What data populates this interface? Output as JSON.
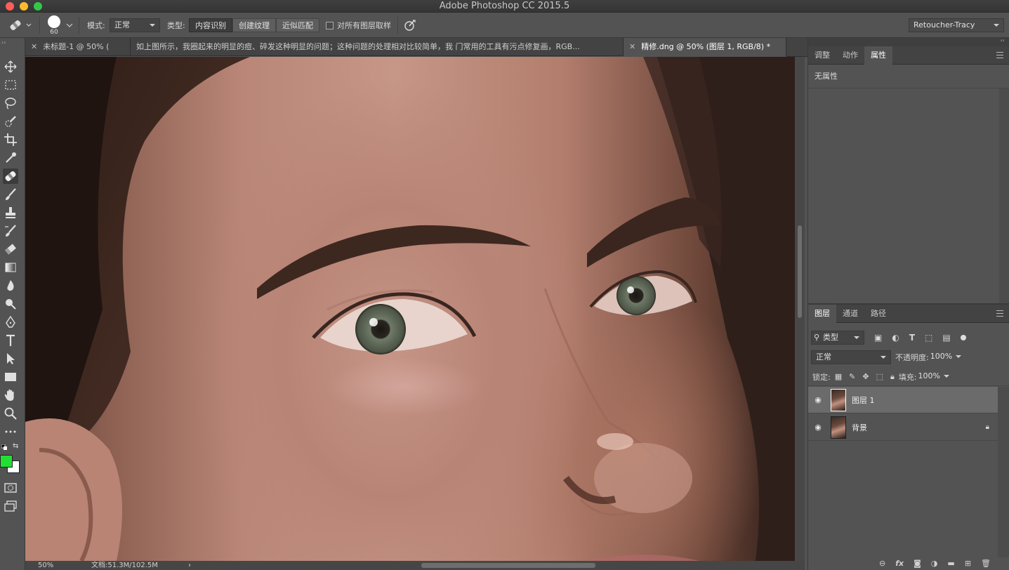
{
  "window": {
    "title": "Adobe Photoshop CC 2015.5"
  },
  "options": {
    "brush_size": "60",
    "mode_label": "模式:",
    "mode_value": "正常",
    "type_label": "类型:",
    "type_buttons": [
      "内容识别",
      "创建纹理",
      "近似匹配"
    ],
    "sample_all_label": "对所有图层取样",
    "workspace": "Retoucher-Tracy"
  },
  "doc_tabs": [
    {
      "label": "未标题-1 @ 50% (",
      "active": false
    },
    {
      "label": "如上图所示，我圈起来的明显的痘、碎发这种明显的问题；这种问题的处理相对比较简单，我 门常用的工具有污点修复画，RGB...",
      "active": false
    },
    {
      "label": "精修.dng @ 50% (图层 1, RGB/8) *",
      "active": true
    }
  ],
  "status": {
    "zoom": "50%",
    "doc_size": "文档:51.3M/102.5M"
  },
  "properties_panel": {
    "tabs": [
      "调整",
      "动作",
      "属性"
    ],
    "active_tab": "属性",
    "content": "无属性"
  },
  "layers_panel": {
    "tabs": [
      "图层",
      "通道",
      "路径"
    ],
    "active_tab": "图层",
    "filter_label": "类型",
    "blend_mode": "正常",
    "opacity_label": "不透明度:",
    "opacity_value": "100%",
    "lock_label": "锁定:",
    "fill_label": "填充:",
    "fill_value": "100%",
    "layers": [
      {
        "name": "图层 1",
        "selected": true,
        "locked": false
      },
      {
        "name": "背景",
        "selected": false,
        "locked": true
      }
    ]
  },
  "colors": {
    "foreground": "#22e033",
    "background": "#ffffff"
  }
}
